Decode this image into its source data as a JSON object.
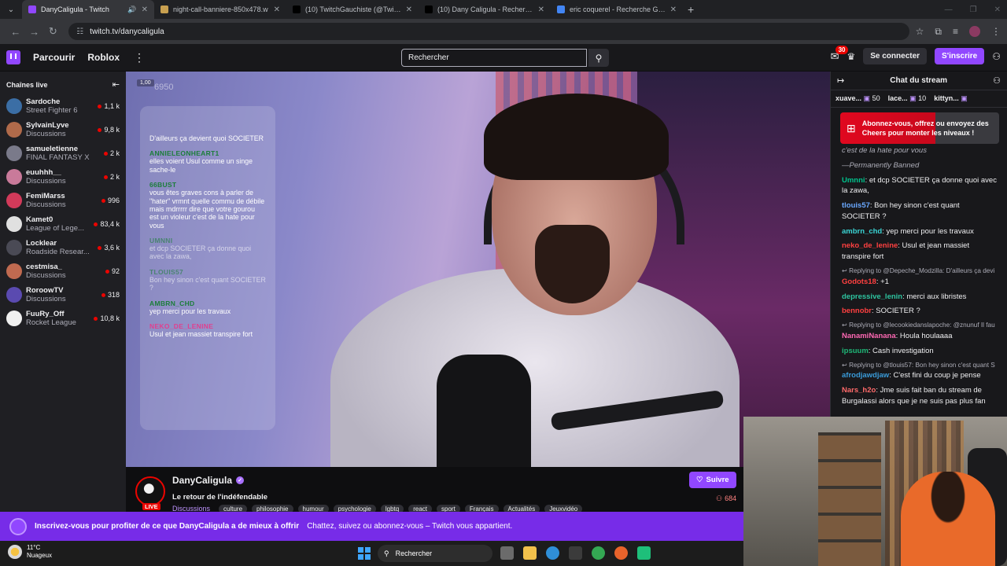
{
  "browser": {
    "tabs": [
      {
        "title": "DanyCaligula - Twitch",
        "color": "#9147ff",
        "active": true
      },
      {
        "title": "night-call-banniere-850x478.w",
        "color": "#c8a050",
        "active": false
      },
      {
        "title": "(10) TwitchGauchiste (@Twitch",
        "color": "#000000",
        "active": false
      },
      {
        "title": "(10) Dany Caligula - Recherche",
        "color": "#000000",
        "active": false
      },
      {
        "title": "eric coquerel - Recherche Goo",
        "color": "#4285f4",
        "active": false
      }
    ],
    "url": "twitch.tv/danycaligula"
  },
  "nav": {
    "browse": "Parcourir",
    "category": "Roblox",
    "search_placeholder": "Rechercher",
    "inbox_count": "30",
    "login": "Se connecter",
    "signup": "S'inscrire"
  },
  "sidebar": {
    "title": "Chaînes live",
    "channels": [
      {
        "name": "Sardoche",
        "game": "Street Fighter 6",
        "viewers": "1,1 k",
        "color": "#3b6ea5"
      },
      {
        "name": "SylvainLyve",
        "game": "Discussions",
        "viewers": "9,8 k",
        "color": "#b06a4a"
      },
      {
        "name": "samueletienne",
        "game": "FINAL FANTASY X",
        "viewers": "2 k",
        "color": "#7a7a8a"
      },
      {
        "name": "euuhhh__",
        "game": "Discussions",
        "viewers": "2 k",
        "color": "#c97a9a"
      },
      {
        "name": "FemiMarss",
        "game": "Discussions",
        "viewers": "996",
        "color": "#d23a5a"
      },
      {
        "name": "Kamet0",
        "game": "League of Lege...",
        "viewers": "83,4 k",
        "color": "#e0e0e0"
      },
      {
        "name": "Locklear",
        "game": "Roadside Resear...",
        "viewers": "3,6 k",
        "color": "#4a4a55"
      },
      {
        "name": "cestmisa_",
        "game": "Discussions",
        "viewers": "92",
        "color": "#c06a50"
      },
      {
        "name": "RoroowTV",
        "game": "Discussions",
        "viewers": "318",
        "color": "#5a4ab0"
      },
      {
        "name": "FuuRy_Off",
        "game": "Rocket League",
        "viewers": "10,8 k",
        "color": "#f0f0f0"
      }
    ]
  },
  "overlay": {
    "badge": "1,00",
    "counter": "6950",
    "messages": [
      {
        "user": "",
        "text": "D'ailleurs ça devient quoi SOCIETER",
        "pink": false,
        "faded": false
      },
      {
        "user": "ANNIELEONHEART1",
        "text": "elles voient Usul comme un singe sache-le",
        "pink": false,
        "faded": false
      },
      {
        "user": "66BUST",
        "text": "vous êtes graves cons à parler de \"hater\" vrmnt quelle commu de débile mais mdrrrrr dire que votre gourou est un violeur c'est de la hate pour vous",
        "pink": false,
        "faded": false
      },
      {
        "user": "UMNNI",
        "text": "et dcp SOCIETER ça donne quoi avec la zawa,",
        "pink": false,
        "faded": true
      },
      {
        "user": "TLOUIS57",
        "text": "Bon hey sinon c'est quant SOCIETER ?",
        "pink": false,
        "faded": true
      },
      {
        "user": "AMBRN_CHD",
        "text": "yep merci pour les travaux",
        "pink": false,
        "faded": false
      },
      {
        "user": "NEKO_DE_LENINE",
        "text": "Usul et jean massiet transpire fort",
        "pink": true,
        "faded": false
      }
    ]
  },
  "stream": {
    "name": "DanyCaligula",
    "live_label": "LIVE",
    "title": "Le retour de l'indéfendable",
    "category": "Discussions",
    "tags": [
      "culture",
      "philosophie",
      "humour",
      "psychologie",
      "lgbtq",
      "react",
      "sport",
      "Français",
      "Actualités",
      "Jeuxvidéo"
    ],
    "follow": "Suivre",
    "viewers": "684"
  },
  "chat": {
    "title": "Chat du stream",
    "leaders": [
      {
        "name": "xuave...",
        "count": "50"
      },
      {
        "name": "lace...",
        "count": "10"
      },
      {
        "name": "kittyn...",
        "count": ""
      }
    ],
    "promo": "Abonnez-vous, offrez ou envoyez des Cheers pour monter les niveaux !",
    "messages": [
      {
        "kind": "sys",
        "user": "",
        "text": "c'est de la hate pour vous",
        "color": ""
      },
      {
        "kind": "sys",
        "user": "",
        "text": "—Permanently Banned",
        "color": ""
      },
      {
        "kind": "msg",
        "user": "Umnni",
        "text": ": et dcp SOCIETER ça donne quoi avec la zawa,",
        "color": "#00c28c"
      },
      {
        "kind": "msg",
        "user": "tlouis57",
        "text": ": Bon hey sinon c'est quant SOCIETER ?",
        "color": "#6aa8ff"
      },
      {
        "kind": "msg",
        "user": "ambrn_chd",
        "text": ": yep merci pour les travaux",
        "color": "#3ad4d4"
      },
      {
        "kind": "msg",
        "user": "neko_de_lenine",
        "text": ": Usul et jean massiet transpire fort",
        "color": "#ff4040"
      },
      {
        "kind": "reply",
        "user": "",
        "text": "Replying to @Depeche_Modzilla: D'ailleurs ça devi",
        "color": ""
      },
      {
        "kind": "msg",
        "user": "Godots18",
        "text": ": +1",
        "color": "#ff4040"
      },
      {
        "kind": "msg",
        "user": "depressive_lenin",
        "text": ": merci aux libristes",
        "color": "#2ec4a0"
      },
      {
        "kind": "msg",
        "user": "bennobr",
        "text": ": SOCIETER ?",
        "color": "#ff4040"
      },
      {
        "kind": "reply",
        "user": "",
        "text": "Replying to @lecookiedanslapoche: @znunuf Il fau",
        "color": ""
      },
      {
        "kind": "msg",
        "user": "NanamiNanana",
        "text": ": Houla houlaaaa",
        "color": "#ff69b4"
      },
      {
        "kind": "msg",
        "user": "ipsuum",
        "text": ": Cash investigation",
        "color": "#1fb878"
      },
      {
        "kind": "reply",
        "user": "",
        "text": "Replying to @tlouis57: Bon hey sinon c'est quant S",
        "color": ""
      },
      {
        "kind": "msg",
        "user": "afrodjawdjaw",
        "text": ": C'est fini du coup je pense",
        "color": "#3a9bd9"
      },
      {
        "kind": "msg",
        "user": "Nars_h2o",
        "text": ": Jme suis fait ban du stream de Burgalassi alors que je ne suis pas plus fan",
        "color": "#ff6a6a"
      }
    ]
  },
  "banner": {
    "main": "Inscrivez-vous pour profiter de ce que DanyCaligula a de mieux à offrir",
    "sub": "Chattez, suivez ou abonnez-vous – Twitch vous appartient."
  },
  "taskbar": {
    "temp": "11°C",
    "weather": "Nuageux",
    "search": "Rechercher"
  }
}
